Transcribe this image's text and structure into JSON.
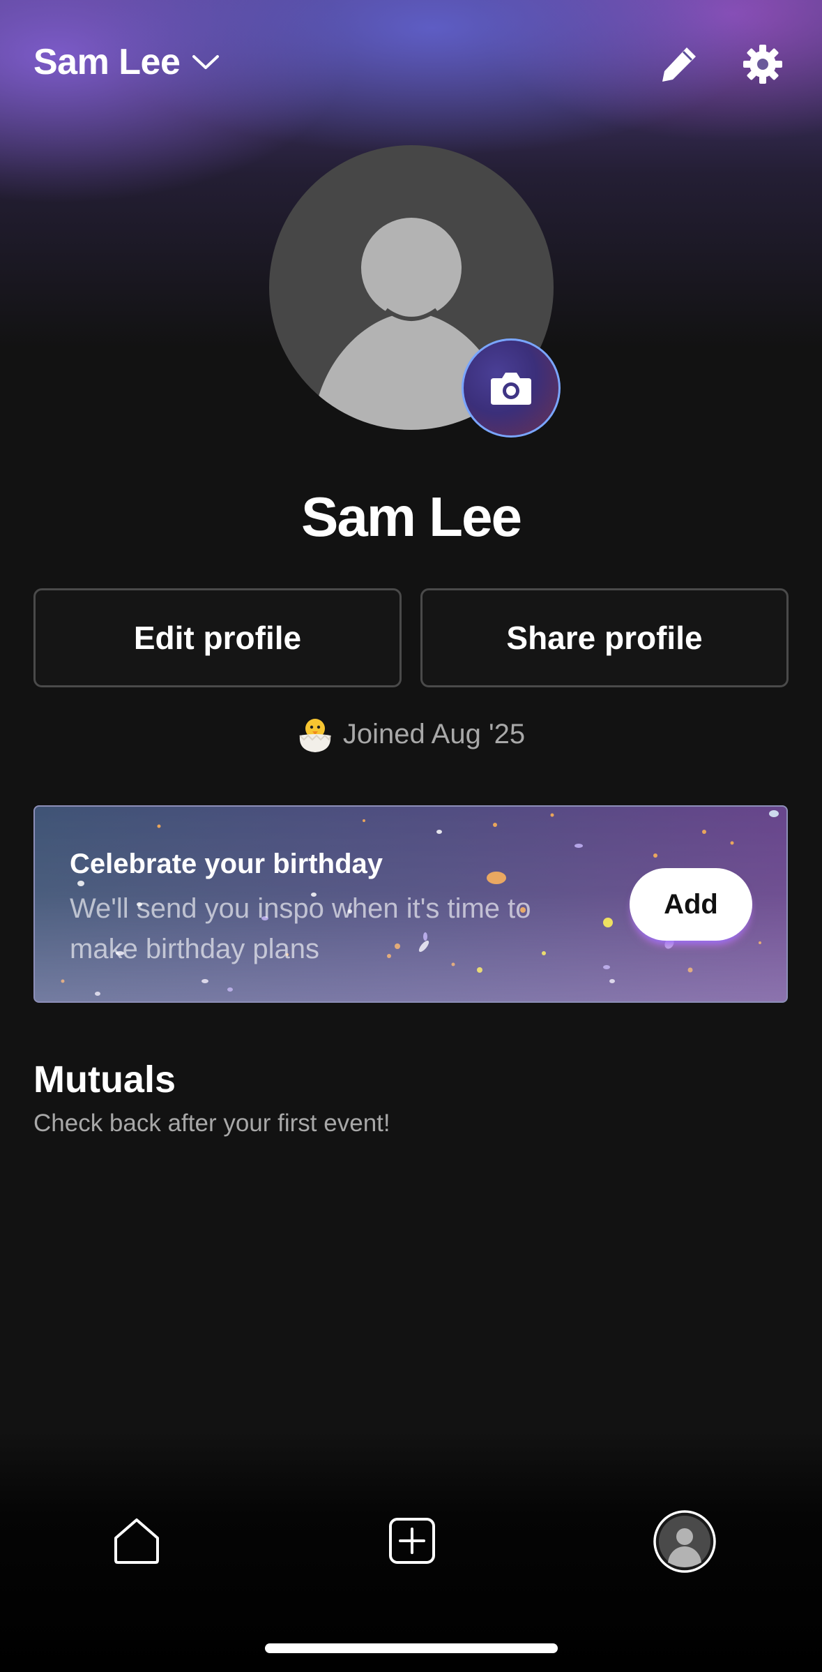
{
  "header": {
    "account_name": "Sam Lee",
    "account_switcher_icon": "chevron-down-icon",
    "edit_icon": "pencil-icon",
    "settings_icon": "gear-icon"
  },
  "profile": {
    "name": "Sam Lee",
    "avatar_icon": "person-silhouette-icon",
    "camera_icon": "camera-icon"
  },
  "actions": {
    "edit_label": "Edit profile",
    "share_label": "Share profile"
  },
  "joined": {
    "emoji_icon": "hatching-chick-icon",
    "text": "Joined Aug '25"
  },
  "birthday_card": {
    "title": "Celebrate your birthday",
    "subtitle": "We'll send you inspo when it's time to make birthday plans",
    "add_label": "Add"
  },
  "mutuals": {
    "title": "Mutuals",
    "subtitle": "Check back after your first event!"
  },
  "bottom_nav": {
    "items": [
      {
        "icon": "home-icon"
      },
      {
        "icon": "plus-square-icon"
      },
      {
        "icon": "profile-avatar-icon",
        "active": true
      }
    ]
  },
  "colors": {
    "background": "#121212",
    "accent_purple": "#5f5fc8",
    "camera_ring": "#7aa6ff"
  }
}
